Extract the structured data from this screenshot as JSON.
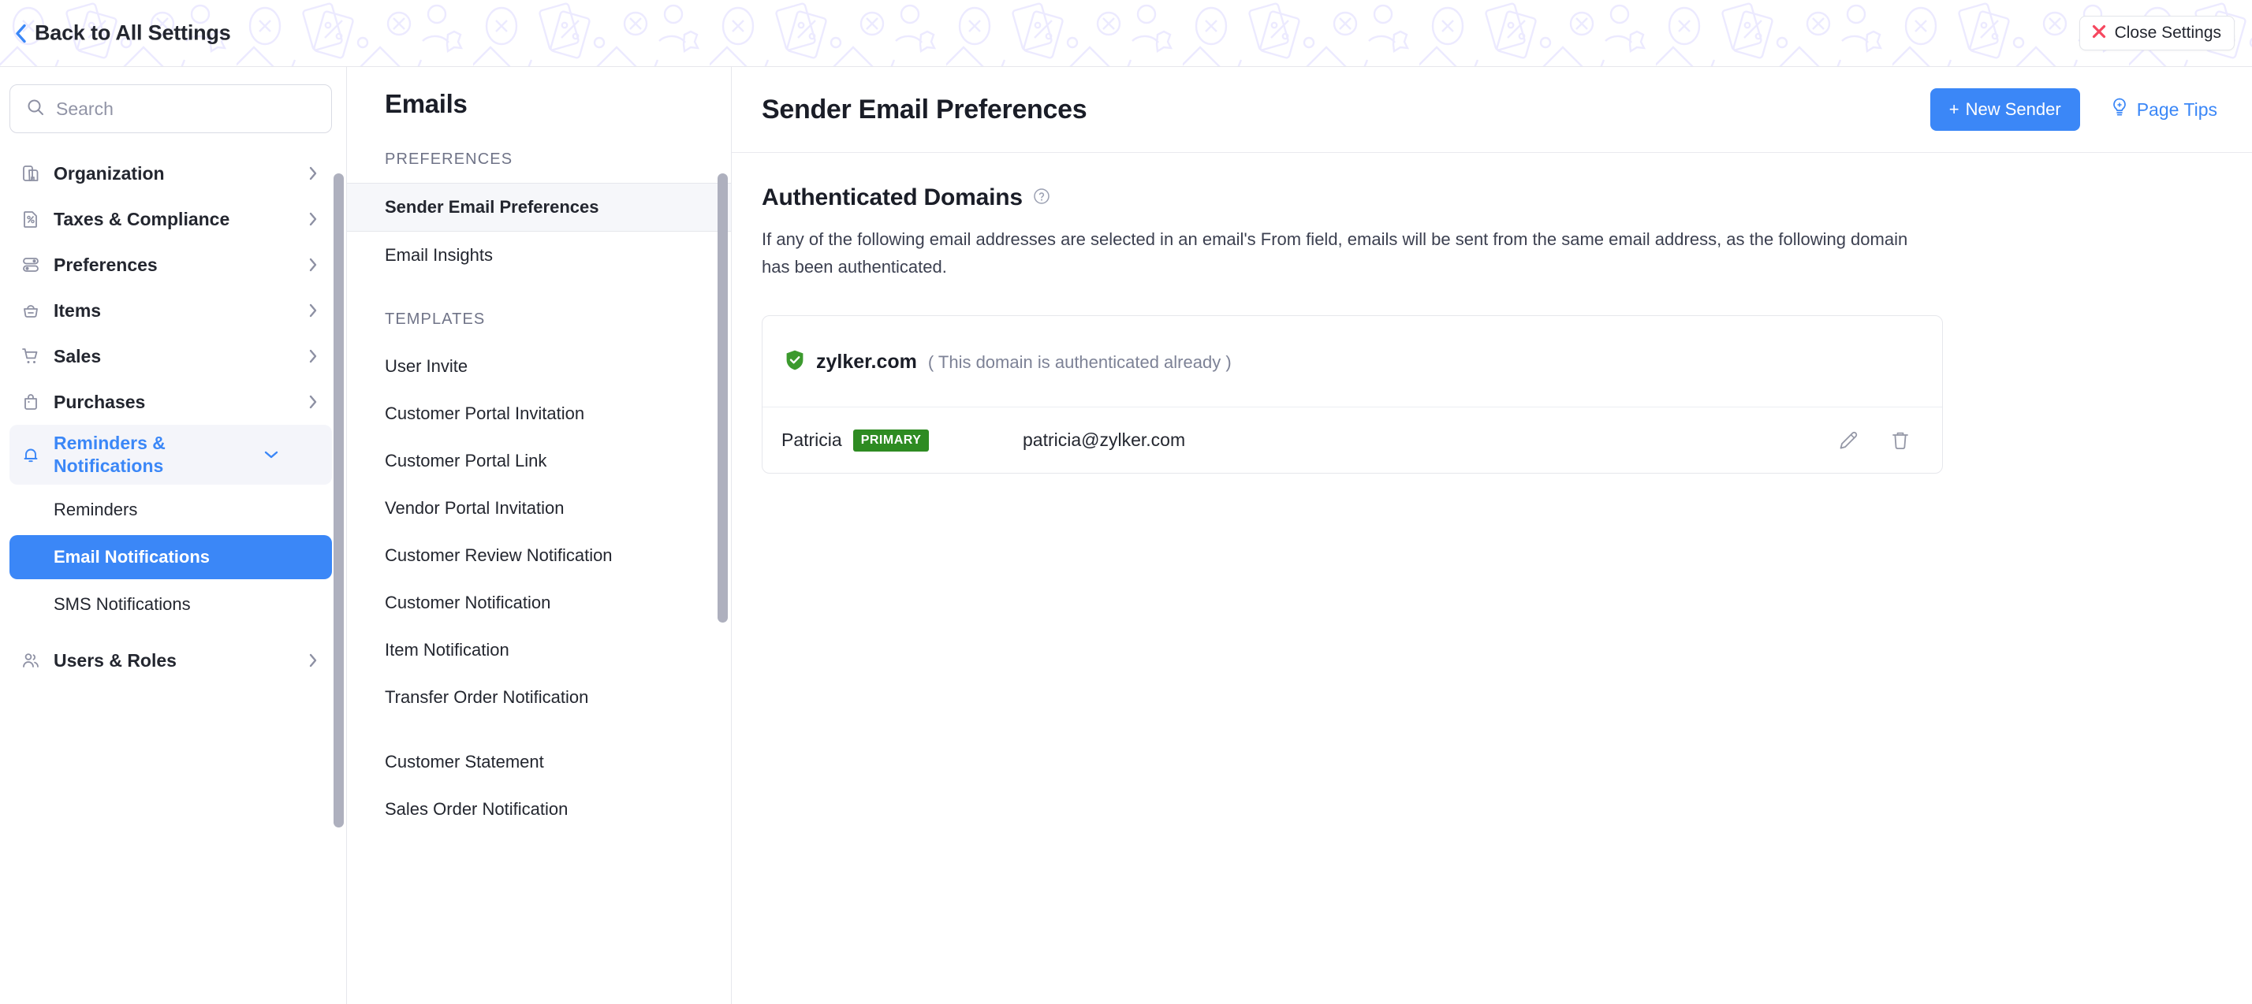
{
  "topbar": {
    "back_label": "Back to All Settings",
    "back_icon": "chevron-left-icon",
    "close_label": "Close Settings",
    "close_icon": "close-x-icon"
  },
  "sidebar": {
    "search": {
      "placeholder": "Search",
      "value": "",
      "icon": "search-icon"
    },
    "items": [
      {
        "label": "Organization",
        "icon": "organization-icon",
        "arrow": "chevron-right-icon"
      },
      {
        "label": "Taxes & Compliance",
        "icon": "tax-document-icon",
        "arrow": "chevron-right-icon"
      },
      {
        "label": "Preferences",
        "icon": "sliders-icon",
        "arrow": "chevron-right-icon"
      },
      {
        "label": "Items",
        "icon": "basket-icon",
        "arrow": "chevron-right-icon"
      },
      {
        "label": "Sales",
        "icon": "cart-icon",
        "arrow": "chevron-right-icon"
      },
      {
        "label": "Purchases",
        "icon": "bag-icon",
        "arrow": "chevron-right-icon"
      }
    ],
    "active_group": {
      "label": "Reminders & Notifications",
      "icon": "bell-icon",
      "arrow": "chevron-down-icon"
    },
    "sub_items": [
      {
        "label": "Reminders",
        "active": false
      },
      {
        "label": "Email Notifications",
        "active": true
      },
      {
        "label": "SMS Notifications",
        "active": false
      }
    ],
    "items_after": [
      {
        "label": "Users & Roles",
        "icon": "users-icon",
        "arrow": "chevron-right-icon"
      }
    ]
  },
  "midpanel": {
    "title": "Emails",
    "section_preferences": "PREFERENCES",
    "preferences_items": [
      {
        "label": "Sender Email Preferences",
        "selected": true
      },
      {
        "label": "Email Insights",
        "selected": false
      }
    ],
    "section_templates": "TEMPLATES",
    "templates_group_1": [
      "User Invite",
      "Customer Portal Invitation",
      "Customer Portal Link",
      "Vendor Portal Invitation",
      "Customer Review Notification",
      "Customer Notification",
      "Item Notification",
      "Transfer Order Notification"
    ],
    "templates_group_2": [
      "Customer Statement",
      "Sales Order Notification"
    ]
  },
  "main": {
    "title": "Sender Email Preferences",
    "new_sender_label": "New Sender",
    "new_sender_plus": "+",
    "page_tips_label": "Page Tips",
    "page_tips_icon": "lightbulb-icon",
    "section": {
      "title": "Authenticated Domains",
      "help_icon": "help-circle-icon",
      "description": "If any of the following email addresses are selected in an email's From field, emails will be sent from the same email address, as the following domain has been authenticated."
    },
    "domain_card": {
      "verified_icon": "shield-check-icon",
      "domain": "zylker.com",
      "note": "( This domain is authenticated already )",
      "senders": [
        {
          "name": "Patricia",
          "badge": "PRIMARY",
          "email": "patricia@zylker.com",
          "edit_icon": "pencil-icon",
          "delete_icon": "trash-icon"
        }
      ]
    }
  },
  "colors": {
    "accent_blue": "#3b87f7",
    "badge_green": "#2e8b22",
    "close_red": "#f6475f",
    "shield_green": "#3c9a2e",
    "text_dark": "#23262f",
    "text_muted": "#7d8296",
    "scrollbar": "#aeb0be"
  }
}
